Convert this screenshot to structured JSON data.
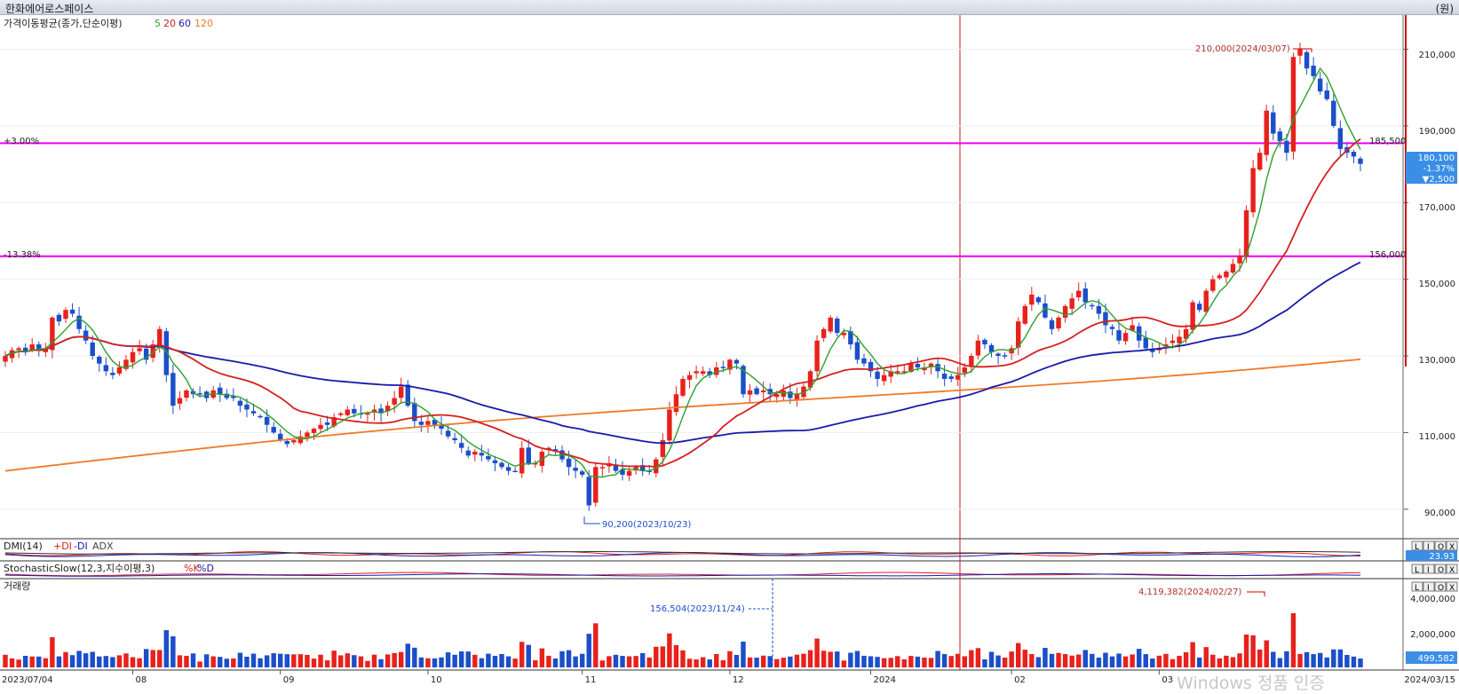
{
  "window": {
    "title": "한화에어로스페이스",
    "unit": "(원)"
  },
  "colors": {
    "up": "#e8211c",
    "down": "#1b4fc9",
    "ma5": "#2ca02c",
    "ma20": "#d62020",
    "ma60": "#1a1aa8",
    "ma120": "#ee7a2a",
    "hline": "#ee00ee",
    "marker": "#cc0000"
  },
  "price_panel": {
    "label": "가격이동평균(종가,단순이평)",
    "ma_labels": [
      "5",
      "20",
      "60",
      "120"
    ],
    "hline_upper": {
      "label": "+3.00%",
      "value": 185500,
      "value_label": "185,500"
    },
    "hline_lower": {
      "label": "-13.38%",
      "value": 156000,
      "value_label": "156,000"
    },
    "high_annotation": "210,000(2024/03/07)",
    "low_annotation": "90,200(2023/10/23)",
    "current": {
      "price": "180,100",
      "change_pct": "-1.37%",
      "change": "▼2,500"
    },
    "y_ticks": [
      "210,000",
      "190,000",
      "170,000",
      "150,000",
      "130,000",
      "110,000",
      "90,000"
    ]
  },
  "dmi_panel": {
    "label": "DMI(14)",
    "series": [
      "+DI",
      "-DI",
      "ADX"
    ],
    "value": "23.93"
  },
  "stoch_panel": {
    "label": "StochasticSlow(12,3,지수이평,3)",
    "series": [
      "%K",
      "%D"
    ]
  },
  "volume_panel": {
    "label": "거래량",
    "annotation_max": "4,119,382(2024/02/27)",
    "annotation_min": "156,504(2023/11/24)",
    "y_ticks": [
      "4,000,000",
      "2,000,000"
    ],
    "current": "499,582"
  },
  "x_axis": {
    "start": "2023/07/04",
    "end": "2024/03/15",
    "months": [
      "08",
      "09",
      "10",
      "11",
      "12",
      "2024",
      "02",
      "03"
    ]
  },
  "panel_buttons": [
    "L",
    "I",
    "O",
    "X"
  ],
  "watermark": "Windows 정품 인증",
  "chart_data": {
    "type": "candlestick",
    "x_range": [
      "2023/07/04",
      "2024/03/15"
    ],
    "ylim": [
      83000,
      218000
    ],
    "closes": [
      130000,
      131500,
      132000,
      131000,
      133000,
      131500,
      132000,
      140000,
      139000,
      142000,
      141000,
      137000,
      134000,
      130000,
      128000,
      126000,
      125000,
      127000,
      129000,
      131000,
      132000,
      129000,
      133000,
      137000,
      125000,
      117000,
      119000,
      121000,
      120000,
      120000,
      119000,
      121000,
      120000,
      119000,
      119000,
      117000,
      116000,
      115000,
      114000,
      112000,
      110000,
      108000,
      107000,
      108000,
      109000,
      110000,
      111000,
      112000,
      112000,
      114000,
      115000,
      116000,
      115000,
      115000,
      115000,
      116000,
      115000,
      117000,
      119000,
      122000,
      117000,
      113000,
      112000,
      113000,
      112000,
      111000,
      109000,
      108000,
      106000,
      104000,
      105000,
      104000,
      103000,
      102000,
      101000,
      100000,
      100000,
      106000,
      102000,
      102000,
      105000,
      106000,
      105000,
      103000,
      101000,
      100000,
      99000,
      91000,
      101000,
      101000,
      102000,
      100000,
      99000,
      100000,
      101000,
      100000,
      100000,
      103000,
      108000,
      116000,
      120000,
      124000,
      125000,
      126000,
      126000,
      125000,
      127000,
      127000,
      129000,
      128000,
      120000,
      121000,
      120000,
      121000,
      120000,
      120000,
      121000,
      119000,
      120000,
      122000,
      126000,
      134000,
      137000,
      140000,
      136000,
      136000,
      133000,
      129000,
      128000,
      126000,
      124000,
      125000,
      126000,
      126000,
      126000,
      128000,
      127000,
      127000,
      128000,
      126000,
      124000,
      124000,
      125000,
      127000,
      130000,
      134000,
      133000,
      131000,
      130000,
      130000,
      132000,
      139000,
      143000,
      146000,
      144000,
      140000,
      137000,
      140000,
      143000,
      145000,
      147000,
      144000,
      143000,
      141000,
      138000,
      137000,
      134000,
      136000,
      138000,
      134000,
      132000,
      131000,
      132000,
      133000,
      134000,
      135000,
      137000,
      144000,
      142000,
      147000,
      150000,
      151000,
      152000,
      154000,
      156000,
      168000,
      179000,
      183000,
      194000,
      188000,
      186000,
      183000,
      208000,
      210000,
      205000,
      203000,
      199000,
      197000,
      190000,
      184000,
      183000,
      182000,
      180100
    ],
    "ma_series": [
      {
        "name": "5"
      },
      {
        "name": "20"
      },
      {
        "name": "60"
      },
      {
        "name": "120"
      }
    ],
    "volume_max": 4119382,
    "volume_last": 499582
  }
}
